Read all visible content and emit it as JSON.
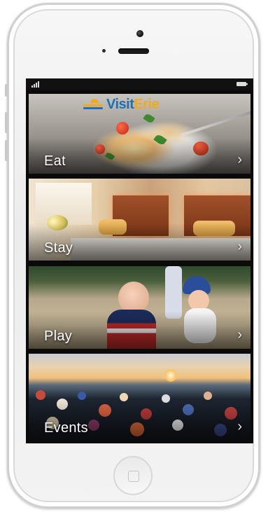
{
  "app": {
    "logo": {
      "part1": "Visit",
      "part2": "Erie"
    },
    "tiles": [
      {
        "label": "Eat",
        "chevron": "›"
      },
      {
        "label": "Stay",
        "chevron": "›"
      },
      {
        "label": "Play",
        "chevron": "›"
      },
      {
        "label": "Events",
        "chevron": "›"
      }
    ]
  },
  "icons": [
    "signal-icon",
    "battery-icon",
    "chevron-right-icon",
    "home-button-icon"
  ],
  "colors": {
    "logo_blue": "#1f6fb3",
    "logo_orange": "#f2a91d",
    "tile_text": "#ffffff"
  }
}
